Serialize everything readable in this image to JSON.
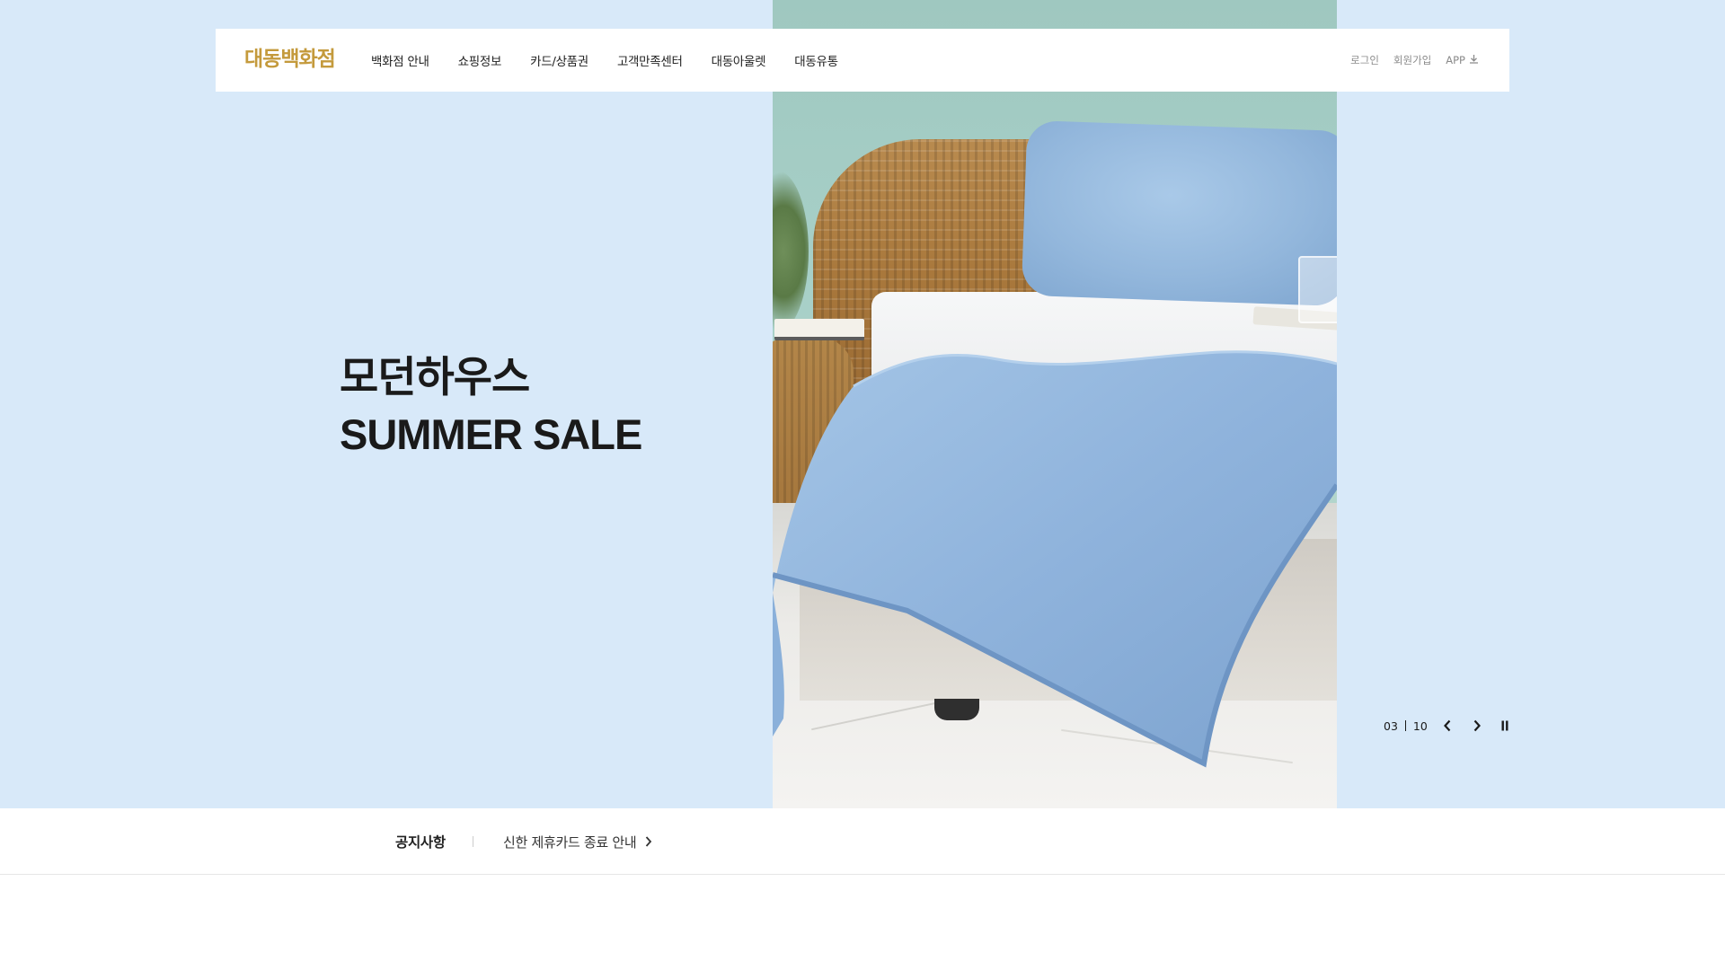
{
  "header": {
    "logo": "대동백화점",
    "nav": [
      {
        "label": "백화점 안내"
      },
      {
        "label": "쇼핑정보"
      },
      {
        "label": "카드/상품권"
      },
      {
        "label": "고객만족센터"
      },
      {
        "label": "대동아울렛"
      },
      {
        "label": "대동유통"
      }
    ],
    "util": {
      "login": "로그인",
      "signup": "회원가입",
      "app": "APP"
    }
  },
  "hero": {
    "title_line1": "모던하우스",
    "title_line2": "SUMMER SALE",
    "slide_current": "03",
    "slide_total": "10",
    "background_color": "#d8e9f9",
    "product_color": "#8fb3dc"
  },
  "notice": {
    "label": "공지사항",
    "item": "신한 제휴카드 종료 안내"
  },
  "icons": {
    "download": "download-icon",
    "prev": "chevron-left-icon",
    "next": "chevron-right-icon",
    "pause": "pause-icon",
    "notice_arrow": "chevron-right-icon"
  },
  "colors": {
    "logo": "#c49a3c",
    "text": "#222222",
    "muted": "#8a8a8a"
  }
}
